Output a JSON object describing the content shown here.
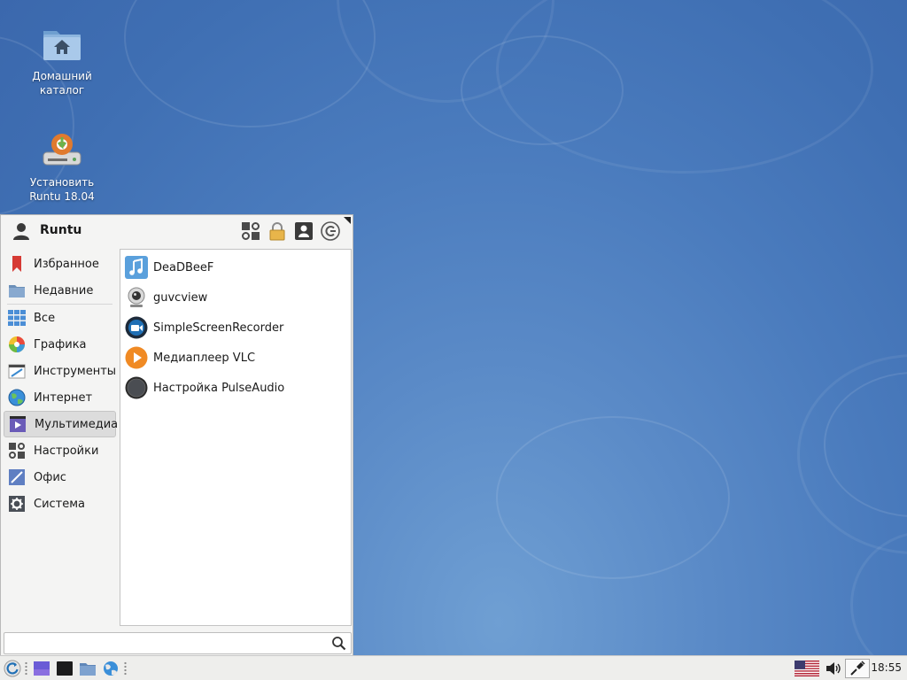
{
  "desktop": {
    "icons": [
      {
        "label": "Домашний каталог",
        "icon": "home-folder-icon"
      },
      {
        "label": "Установить Runtu 18.04",
        "icon": "installer-icon"
      }
    ]
  },
  "menu": {
    "user": "Runtu",
    "header_buttons": [
      "settings-manager-icon",
      "lock-icon",
      "switch-user-icon",
      "logout-icon"
    ],
    "categories": [
      {
        "label": "Избранное",
        "icon": "bookmark-icon"
      },
      {
        "label": "Недавние",
        "icon": "recent-folder-icon"
      },
      {
        "label": "Все",
        "icon": "grid-icon"
      },
      {
        "label": "Графика",
        "icon": "graphics-icon"
      },
      {
        "label": "Инструменты",
        "icon": "tools-icon"
      },
      {
        "label": "Интернет",
        "icon": "internet-icon"
      },
      {
        "label": "Мультимедиа",
        "icon": "multimedia-icon",
        "selected": true
      },
      {
        "label": "Настройки",
        "icon": "settings-icon"
      },
      {
        "label": "Офис",
        "icon": "office-icon"
      },
      {
        "label": "Система",
        "icon": "system-icon"
      }
    ],
    "apps": [
      {
        "label": "DeaDBeeF",
        "icon": "music-note-icon"
      },
      {
        "label": "guvcview",
        "icon": "webcam-icon"
      },
      {
        "label": "SimpleScreenRecorder",
        "icon": "screen-recorder-icon"
      },
      {
        "label": "Медиаплеер VLC",
        "icon": "vlc-play-icon"
      },
      {
        "label": "Настройка PulseAudio",
        "icon": "pulseaudio-knob-icon"
      }
    ],
    "search": {
      "value": "",
      "placeholder": ""
    }
  },
  "taskbar": {
    "clock": "18:55",
    "layout": "us-flag-icon"
  },
  "colors": {
    "desktop": "#4a7bbd",
    "menu_bg": "#f4f4f3",
    "selection": "#dcdcdc"
  }
}
